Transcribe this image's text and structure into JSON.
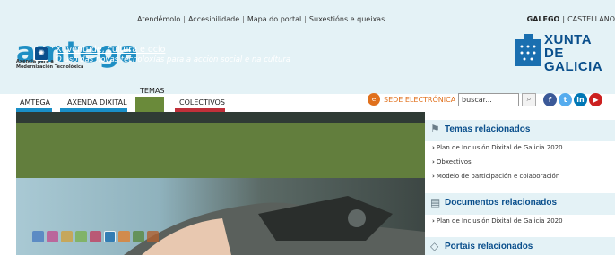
{
  "top_links": {
    "atendemolo": "Atendémolo",
    "accesibilidade": "Accesibilidade",
    "mapa": "Mapa do portal",
    "suxestions": "Suxestións e queixas"
  },
  "languages": {
    "galego": "GALEGO",
    "castellano": "CASTELLANO"
  },
  "logo": {
    "name": "amtega",
    "subtitle_line1": "Axencia para a",
    "subtitle_line2": "Modernización Tecnolóxica"
  },
  "xunta": {
    "line1": "XUNTA",
    "line2": "DE GALICIA"
  },
  "nav": {
    "items": [
      {
        "label": "AMTEGA",
        "color": "#1a8fc7"
      },
      {
        "label": "AXENDA DIXITAL",
        "color": "#1a8fc7"
      },
      {
        "label": "TEMAS",
        "color": "#6a8a3a"
      },
      {
        "label": "COLECTIVOS",
        "color": "#c0303a"
      }
    ]
  },
  "sede": {
    "label": "SEDE ELECTRÓNICA"
  },
  "search": {
    "value": "buscar..."
  },
  "social": [
    {
      "icon": "facebook-icon",
      "glyph": "f",
      "color": "#3b5998"
    },
    {
      "icon": "twitter-icon",
      "glyph": "t",
      "color": "#55acee"
    },
    {
      "icon": "linkedin-icon",
      "glyph": "in",
      "color": "#0077b5"
    },
    {
      "icon": "youtube-icon",
      "glyph": "▶",
      "color": "#cc2020"
    }
  ],
  "hero": {
    "title": "Xuventude, cultura e ocio",
    "subtitle": "O uso das novas tecnoloxías para a acción social e na cultura"
  },
  "thumbs": [
    "#4a7cc0",
    "#c05090",
    "#d0a040",
    "#7ab050",
    "#c04060",
    "#1a6fb0",
    "#e08030",
    "#5a8a40",
    "#b06030"
  ],
  "sidebar": {
    "temas": {
      "title": "Temas relacionados",
      "links": [
        "Plan de Inclusión Dixital de Galicia 2020",
        "Obxectivos",
        "Modelo de participación e colaboración"
      ]
    },
    "documentos": {
      "title": "Documentos relacionados",
      "links": [
        "Plan de Inclusión Dixital de Galicia 2020"
      ]
    },
    "portais": {
      "title": "Portais relacionados"
    }
  }
}
